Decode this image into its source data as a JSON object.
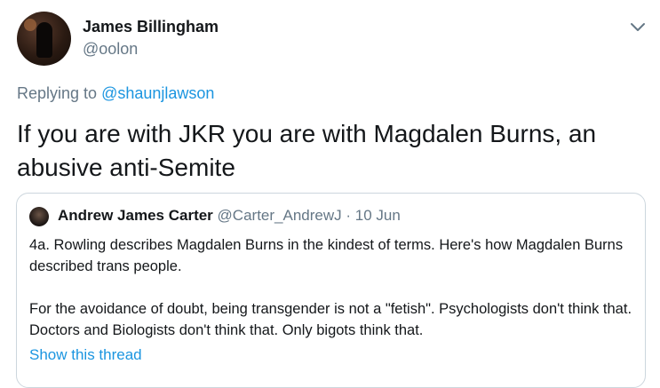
{
  "tweet": {
    "author_name": "James Billingham",
    "author_handle": "@oolon",
    "replying_prefix": "Replying to ",
    "replying_to": "@shaunjlawson",
    "text": "If you are with JKR you are with Magdalen Burns, an abusive anti-Semite",
    "menu_icon": "chevron-down-icon"
  },
  "quote": {
    "author_name": "Andrew James Carter",
    "author_handle": "@Carter_AndrewJ",
    "separator": " · ",
    "date": "10 Jun",
    "paragraph1": "4a. Rowling describes Magdalen Burns in the kindest of terms. Here's how Magdalen Burns described trans people.",
    "paragraph2": "For the avoidance of doubt, being transgender is not a \"fetish\". Psychologists don't think that. Doctors and Biologists don't think that. Only bigots think that.",
    "show_thread": "Show this thread"
  },
  "colors": {
    "text": "#14171a",
    "secondary": "#657786",
    "link": "#1b95e0",
    "border": "#ccd6dd"
  }
}
